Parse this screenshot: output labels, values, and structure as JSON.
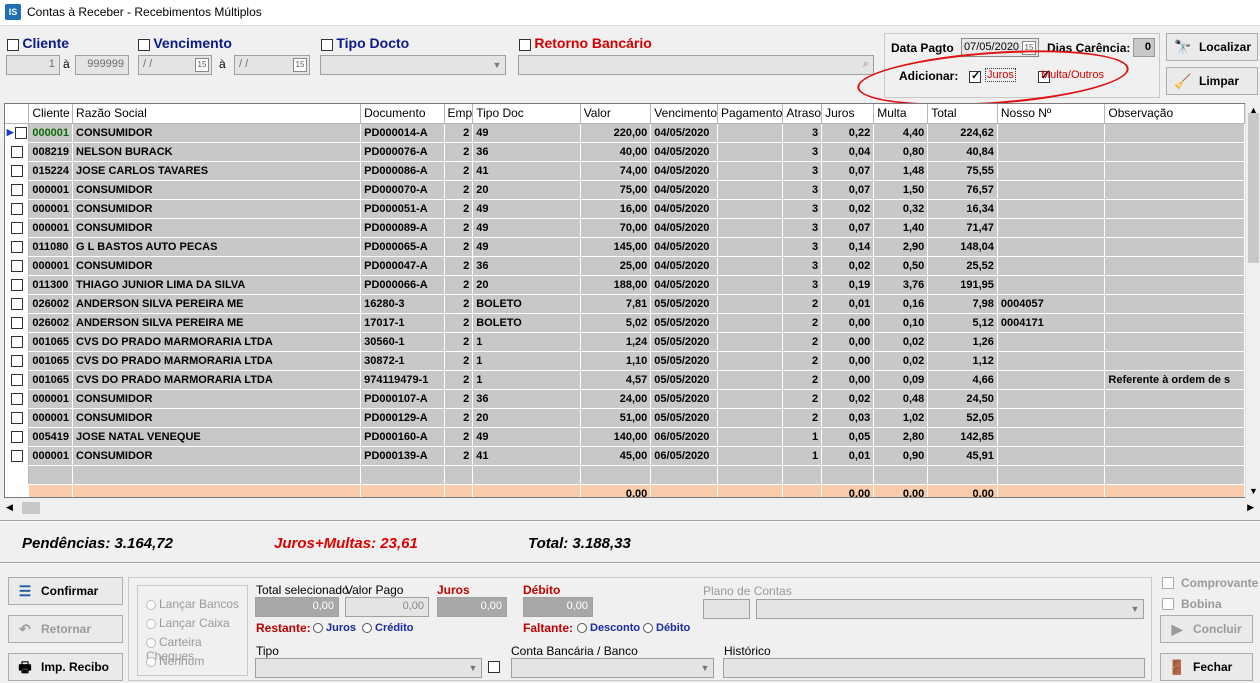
{
  "window": {
    "title": "Contas à Receber - Recebimentos Múltiplos",
    "app_icon": "IS"
  },
  "filters": {
    "cliente_label": "Cliente",
    "cliente_from": "1",
    "cliente_a": "à",
    "cliente_to": "999999",
    "vencimento_label": "Vencimento",
    "venc_from": "/ /",
    "venc_a": "à",
    "venc_to": "/ /",
    "tipo_docto_label": "Tipo Docto",
    "retorno_label": "Retorno Bancário"
  },
  "pagto": {
    "data_label": "Data Pagto",
    "data_value": "07/05/2020",
    "dias_label": "Dias Carência:",
    "dias_value": "0",
    "adicionar_label": "Adicionar:",
    "juros_label": "Juros",
    "multa_label": "Multa/Outros"
  },
  "buttons": {
    "localizar": "Localizar",
    "limpar": "Limpar",
    "confirmar": "Confirmar",
    "retornar": "Retornar",
    "imp_recibo": "Imp. Recibo",
    "concluir": "Concluir",
    "fechar": "Fechar"
  },
  "columns": [
    "Cliente",
    "Razão Social",
    "Documento",
    "Emp",
    "Tipo Doc",
    "Valor",
    "Vencimento",
    "Pagamento",
    "Atraso",
    "Juros",
    "Multa",
    "Total",
    "Nosso Nº",
    "Observação"
  ],
  "rows": [
    [
      "000001",
      "CONSUMIDOR",
      "PD000014-A",
      "2",
      "49",
      "220,00",
      "04/05/2020",
      "",
      "3",
      "0,22",
      "4,40",
      "224,62",
      "",
      ""
    ],
    [
      "008219",
      "NELSON BURACK",
      "PD000076-A",
      "2",
      "36",
      "40,00",
      "04/05/2020",
      "",
      "3",
      "0,04",
      "0,80",
      "40,84",
      "",
      ""
    ],
    [
      "015224",
      "JOSE CARLOS TAVARES",
      "PD000086-A",
      "2",
      "41",
      "74,00",
      "04/05/2020",
      "",
      "3",
      "0,07",
      "1,48",
      "75,55",
      "",
      ""
    ],
    [
      "000001",
      "CONSUMIDOR",
      "PD000070-A",
      "2",
      "20",
      "75,00",
      "04/05/2020",
      "",
      "3",
      "0,07",
      "1,50",
      "76,57",
      "",
      ""
    ],
    [
      "000001",
      "CONSUMIDOR",
      "PD000051-A",
      "2",
      "49",
      "16,00",
      "04/05/2020",
      "",
      "3",
      "0,02",
      "0,32",
      "16,34",
      "",
      ""
    ],
    [
      "000001",
      "CONSUMIDOR",
      "PD000089-A",
      "2",
      "49",
      "70,00",
      "04/05/2020",
      "",
      "3",
      "0,07",
      "1,40",
      "71,47",
      "",
      ""
    ],
    [
      "011080",
      "G L BASTOS AUTO PECAS",
      "PD000065-A",
      "2",
      "49",
      "145,00",
      "04/05/2020",
      "",
      "3",
      "0,14",
      "2,90",
      "148,04",
      "",
      ""
    ],
    [
      "000001",
      "CONSUMIDOR",
      "PD000047-A",
      "2",
      "36",
      "25,00",
      "04/05/2020",
      "",
      "3",
      "0,02",
      "0,50",
      "25,52",
      "",
      ""
    ],
    [
      "011300",
      "THIAGO JUNIOR LIMA DA SILVA",
      "PD000066-A",
      "2",
      "20",
      "188,00",
      "04/05/2020",
      "",
      "3",
      "0,19",
      "3,76",
      "191,95",
      "",
      ""
    ],
    [
      "026002",
      "ANDERSON SILVA PEREIRA ME",
      "16280-3",
      "2",
      "BOLETO",
      "7,81",
      "05/05/2020",
      "",
      "2",
      "0,01",
      "0,16",
      "7,98",
      "0004057",
      ""
    ],
    [
      "026002",
      "ANDERSON SILVA PEREIRA ME",
      "17017-1",
      "2",
      "BOLETO",
      "5,02",
      "05/05/2020",
      "",
      "2",
      "0,00",
      "0,10",
      "5,12",
      "0004171",
      ""
    ],
    [
      "001065",
      "CVS DO PRADO MARMORARIA LTDA",
      "30560-1",
      "2",
      "1",
      "1,24",
      "05/05/2020",
      "",
      "2",
      "0,00",
      "0,02",
      "1,26",
      "",
      ""
    ],
    [
      "001065",
      "CVS DO PRADO MARMORARIA LTDA",
      "30872-1",
      "2",
      "1",
      "1,10",
      "05/05/2020",
      "",
      "2",
      "0,00",
      "0,02",
      "1,12",
      "",
      ""
    ],
    [
      "001065",
      "CVS DO PRADO MARMORARIA LTDA",
      "974119479-1",
      "2",
      "1",
      "4,57",
      "05/05/2020",
      "",
      "2",
      "0,00",
      "0,09",
      "4,66",
      "",
      "Referente à ordem de s"
    ],
    [
      "000001",
      "CONSUMIDOR",
      "PD000107-A",
      "2",
      "36",
      "24,00",
      "05/05/2020",
      "",
      "2",
      "0,02",
      "0,48",
      "24,50",
      "",
      ""
    ],
    [
      "000001",
      "CONSUMIDOR",
      "PD000129-A",
      "2",
      "20",
      "51,00",
      "05/05/2020",
      "",
      "2",
      "0,03",
      "1,02",
      "52,05",
      "",
      ""
    ],
    [
      "005419",
      "JOSE NATAL VENEQUE",
      "PD000160-A",
      "2",
      "49",
      "140,00",
      "06/05/2020",
      "",
      "1",
      "0,05",
      "2,80",
      "142,85",
      "",
      ""
    ],
    [
      "000001",
      "CONSUMIDOR",
      "PD000139-A",
      "2",
      "41",
      "45,00",
      "06/05/2020",
      "",
      "1",
      "0,01",
      "0,90",
      "45,91",
      "",
      ""
    ]
  ],
  "totals": {
    "valor": "0,00",
    "juros": "0,00",
    "multa": "0,00",
    "total": "0,00"
  },
  "summary": {
    "pendencias": "Pendências: 3.164,72",
    "juros_multas": "Juros+Multas: 23,61",
    "total": "Total: 3.188,33"
  },
  "bottom": {
    "lancar_bancos": "Lançar Bancos",
    "lancar_caixa": "Lançar Caixa",
    "carteira_cheques": "Carteira Cheques",
    "nenhum": "Nenhum",
    "total_selecionado_label": "Total selecionado",
    "total_selecionado_value": "0,00",
    "valor_pago_label": "Valor Pago",
    "valor_pago_value": "0,00",
    "juros_label": "Juros",
    "juros_value": "0,00",
    "debito_label": "Débito",
    "debito_value": "0,00",
    "restante_label": "Restante:",
    "restante_juros": "Juros",
    "restante_credito": "Crédito",
    "faltante_label": "Faltante:",
    "faltante_desconto": "Desconto",
    "faltante_debito": "Débito",
    "plano_contas_label": "Plano de Contas",
    "tipo_label": "Tipo",
    "conta_bancaria_label": "Conta Bancária / Banco",
    "historico_label": "Histórico",
    "comprovante_label": "Comprovante",
    "bobina_label": "Bobina"
  },
  "colors": {
    "annotation": "#e01010",
    "grid_row": "#c8c8c8",
    "totals_row": "#f8ccaa",
    "filter_label": "#0a1a8a",
    "accent_red": "#d40000"
  }
}
